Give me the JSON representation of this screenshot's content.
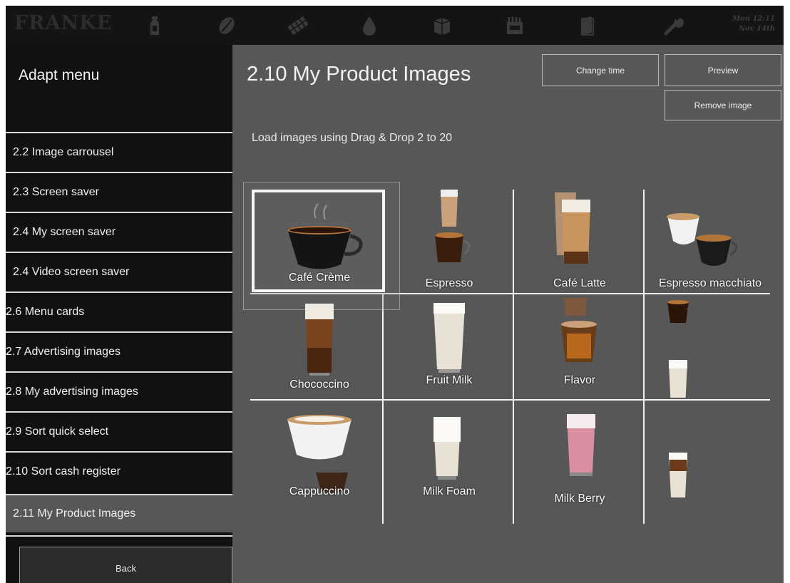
{
  "header": {
    "logo": "FRANKE",
    "clock_line1": "Mon 12:11",
    "clock_line2": "Nov 14th",
    "icons": [
      "milk-carton-icon",
      "coffee-bean-icon",
      "chocolate-icon",
      "water-drop-icon",
      "cups-icon",
      "grinder-icon",
      "book-icon",
      "wrench-icon"
    ]
  },
  "sidebar": {
    "title": "Adapt menu",
    "items": [
      {
        "label": "2.2 Image carrousel"
      },
      {
        "label": "2.3 Screen saver"
      },
      {
        "label": "2.4  My screen saver"
      },
      {
        "label": "2.4 Video screen saver"
      },
      {
        "label": "2.6 Menu cards"
      },
      {
        "label": "2.7 Advertising images"
      },
      {
        "label": "2.8 My advertising images"
      },
      {
        "label": "2.9 Sort quick select"
      },
      {
        "label": "2.10 Sort cash register"
      },
      {
        "label": "2.11 My Product Images"
      }
    ],
    "active_index": 9,
    "back_label": "Back"
  },
  "main": {
    "title": "2.10 My Product Images",
    "change_time_label": "Change time",
    "preview_label": "Preview",
    "remove_image_label": "Remove image",
    "hint": "Load images using Drag & Drop 2 to 20",
    "products": [
      {
        "label": "Café Crème",
        "drink": "cup-black"
      },
      {
        "label": "Espresso",
        "drink": "glass-espresso"
      },
      {
        "label": "Café Latte",
        "drink": "glass-latte"
      },
      {
        "label": "Espresso macchiato",
        "drink": "cup-macchiato"
      },
      {
        "label": "Chococcino",
        "drink": "glass-choco"
      },
      {
        "label": "Fruit Milk",
        "drink": "glass-milk"
      },
      {
        "label": "Flavor",
        "drink": "glass-flavor"
      },
      {
        "label": "",
        "drink": "glass-latte-tall"
      },
      {
        "label": "Cappuccino",
        "drink": "cup-cappuccino"
      },
      {
        "label": "Milk Foam",
        "drink": "glass-foam"
      },
      {
        "label": "Milk Berry",
        "drink": "glass-berry"
      },
      {
        "label": "",
        "drink": "glass-layered"
      }
    ],
    "colors": {
      "coffee": "#3a1d0c",
      "crema": "#b3743a",
      "milk": "#e8e2d6",
      "foam": "#f5f5f2",
      "berry": "#d98fa0"
    }
  }
}
